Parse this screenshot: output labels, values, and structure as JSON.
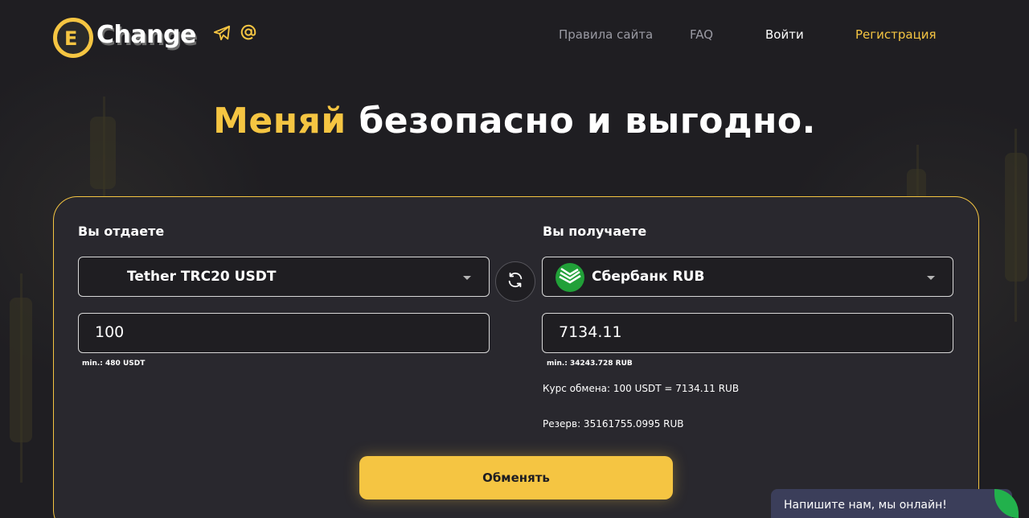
{
  "header": {
    "logo_letter": "E",
    "logo_text": "Change",
    "icons": [
      "telegram-icon",
      "at-sign-icon"
    ],
    "nav": {
      "rules": "Правила сайта",
      "faq": "FAQ",
      "login": "Войти",
      "register": "Регистрация"
    }
  },
  "hero": {
    "accent": "Меняй",
    "rest": " безопасно и выгодно."
  },
  "exchange": {
    "give_label": "Вы отдаете",
    "get_label": "Вы получаете",
    "give_currency": "Tether TRC20 USDT",
    "get_currency": "Сбербанк RUB",
    "give_amount": "100",
    "get_amount": "7134.11",
    "give_min": "min.: 480 USDT",
    "get_min": "min.: 34243.728 RUB",
    "rate": "Курс обмена: 100 USDT = 7134.11 RUB",
    "reserve": "Резерв: 35161755.0995 RUB",
    "submit_label": "Обменять"
  },
  "chat": {
    "text": "Напишите нам, мы онлайн!"
  },
  "colors": {
    "accent": "#f5c542",
    "background": "#1f1e22",
    "card": "#29282e",
    "chat": "#3b3e5a",
    "chat_badge": "#22b14c"
  }
}
